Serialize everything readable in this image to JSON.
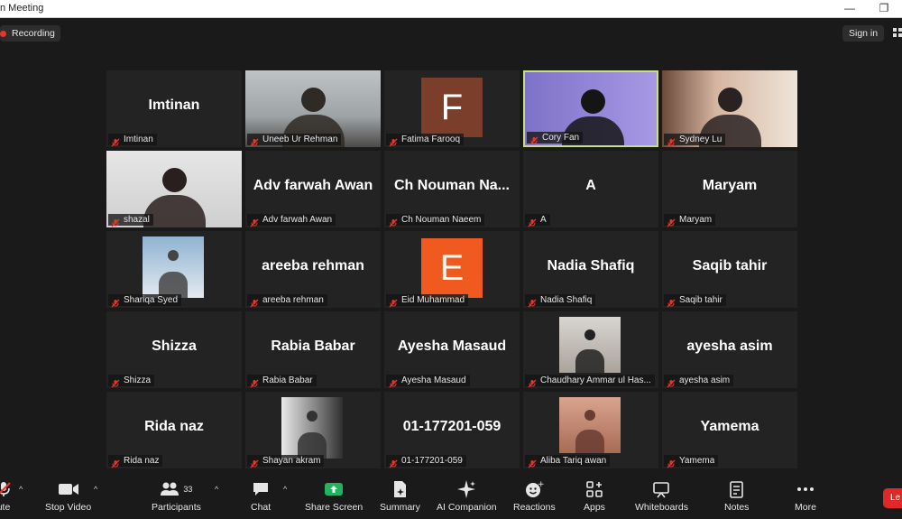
{
  "window": {
    "title": "n Meeting",
    "minimize": "—",
    "restore": "❐"
  },
  "topbar": {
    "recording_label": "Recording",
    "signin_label": "Sign in"
  },
  "tiles": [
    {
      "big": "Imtinan",
      "name": "Imtinan"
    },
    {
      "big": "",
      "name": "Uneeb Ur Rehman"
    },
    {
      "big": "",
      "name": "Fatima Farooq",
      "avatar_letter": "F",
      "avatar_color": "#7a3e2a"
    },
    {
      "big": "",
      "name": "Cory Fan"
    },
    {
      "big": "",
      "name": "Sydney Lu"
    },
    {
      "big": "",
      "name": "shazal"
    },
    {
      "big": "Adv farwah Awan",
      "name": "Adv farwah Awan"
    },
    {
      "big": "Ch Nouman Na...",
      "name": "Ch Nouman Naeem"
    },
    {
      "big": "A",
      "name": "A"
    },
    {
      "big": "Maryam",
      "name": "Maryam"
    },
    {
      "big": "",
      "name": "Shariqa Syed"
    },
    {
      "big": "areeba rehman",
      "name": "areeba rehman"
    },
    {
      "big": "",
      "name": "Eid Muhammad",
      "avatar_letter": "E",
      "avatar_color": "#f05a1e"
    },
    {
      "big": "Nadia Shafiq",
      "name": "Nadia Shafiq"
    },
    {
      "big": "Saqib tahir",
      "name": "Saqib tahir"
    },
    {
      "big": "Shizza",
      "name": "Shizza"
    },
    {
      "big": "Rabia Babar",
      "name": "Rabia Babar"
    },
    {
      "big": "Ayesha Masaud",
      "name": "Ayesha Masaud"
    },
    {
      "big": "",
      "name": "Chaudhary Ammar ul Has..."
    },
    {
      "big": "ayesha asim",
      "name": "ayesha asim"
    },
    {
      "big": "Rida naz",
      "name": "Rida naz"
    },
    {
      "big": "",
      "name": "Shayan akram"
    },
    {
      "big": "01-177201-059",
      "name": "01-177201-059"
    },
    {
      "big": "",
      "name": "Aliba Tariq awan"
    },
    {
      "big": "Yamema",
      "name": "Yamema"
    }
  ],
  "toolbar": {
    "mute": "ute",
    "stop_video": "Stop Video",
    "participants": "Participants",
    "participants_count": "33",
    "chat": "Chat",
    "share_screen": "Share Screen",
    "summary": "Summary",
    "ai_companion": "AI Companion",
    "reactions": "Reactions",
    "apps": "Apps",
    "whiteboards": "Whiteboards",
    "notes": "Notes",
    "more": "More",
    "leave": "Le"
  },
  "colors": {
    "background": "#1a1a1a",
    "tile": "#232323",
    "active_border": "#c5e07e",
    "share_green": "#22b35e",
    "leave_red": "#e02828",
    "mic_muted": "#e5362d"
  }
}
